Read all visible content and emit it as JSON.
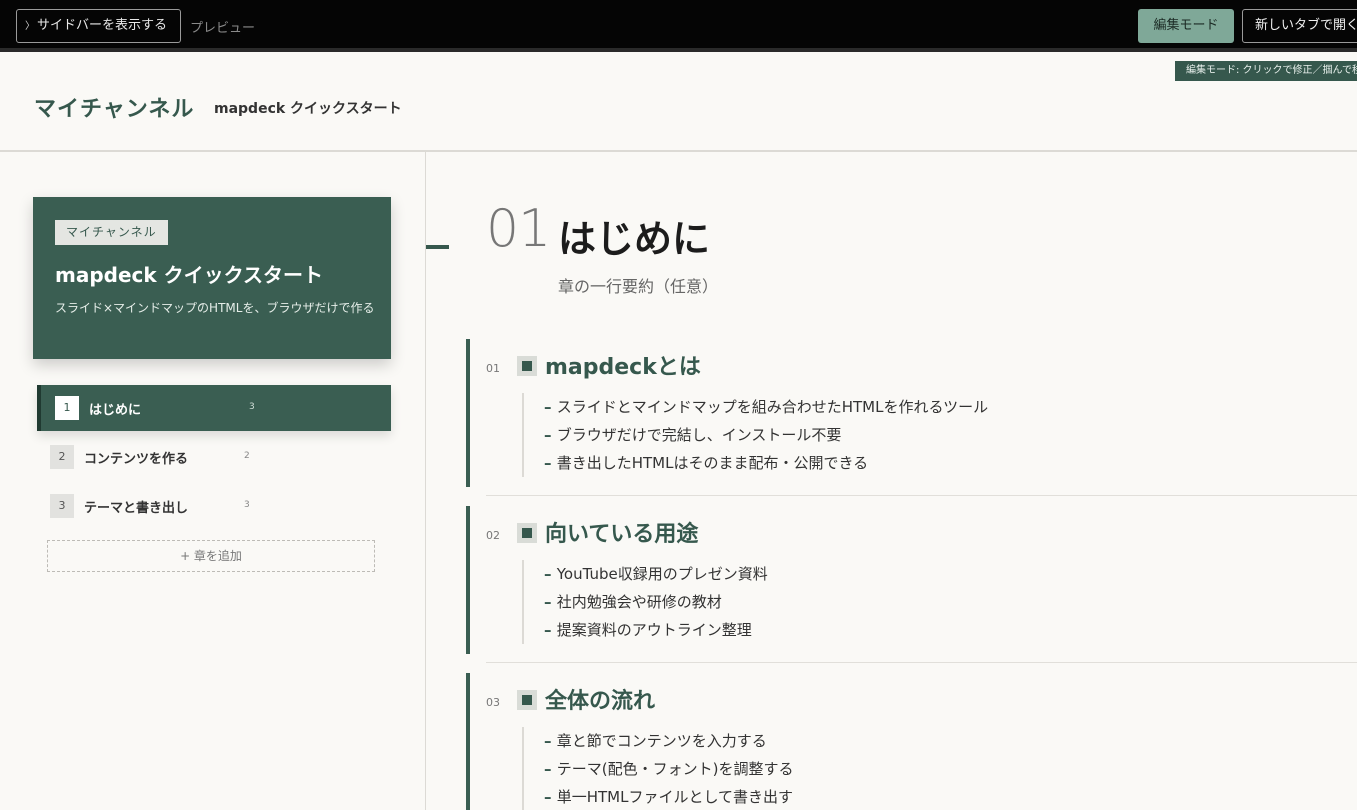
{
  "topbar": {
    "sidebar_toggle_label": "サイドバーを表示する",
    "preview_label": "プレビュー",
    "edit_mode_label": "編集モード",
    "new_tab_label": "新しいタブで開く"
  },
  "header": {
    "edit_hint": "編集モード: クリックで修正／掴んで移動",
    "channel_name": "マイチャンネル",
    "deck_title": "mapdeck クイックスタート"
  },
  "sidebar": {
    "cover": {
      "badge": "マイチャンネル",
      "title": "mapdeck クイックスタート",
      "description": "スライド×マインドマップのHTMLを、ブラウザだけで作る"
    },
    "chapters": [
      {
        "num": "1",
        "title": "はじめに",
        "count": "3",
        "active": true
      },
      {
        "num": "2",
        "title": "コンテンツを作る",
        "count": "2",
        "active": false
      },
      {
        "num": "3",
        "title": "テーマと書き出し",
        "count": "3",
        "active": false
      }
    ],
    "add_chapter_label": "+ 章を追加"
  },
  "main": {
    "chapter_num": "01",
    "chapter_title": "はじめに",
    "chapter_summary": "章の一行要約（任意）",
    "sections": [
      {
        "num": "01",
        "title": "mapdeckとは",
        "bullets": [
          "スライドとマインドマップを組み合わせたHTMLを作れるツール",
          "ブラウザだけで完結し、インストール不要",
          "書き出したHTMLはそのまま配布・公開できる"
        ]
      },
      {
        "num": "02",
        "title": "向いている用途",
        "bullets": [
          "YouTube収録用のプレゼン資料",
          "社内勉強会や研修の教材",
          "提案資料のアウトライン整理"
        ]
      },
      {
        "num": "03",
        "title": "全体の流れ",
        "bullets": [
          "章と節でコンテンツを入力する",
          "テーマ(配色・フォント)を調整する",
          "単一HTMLファイルとして書き出す"
        ]
      }
    ]
  }
}
